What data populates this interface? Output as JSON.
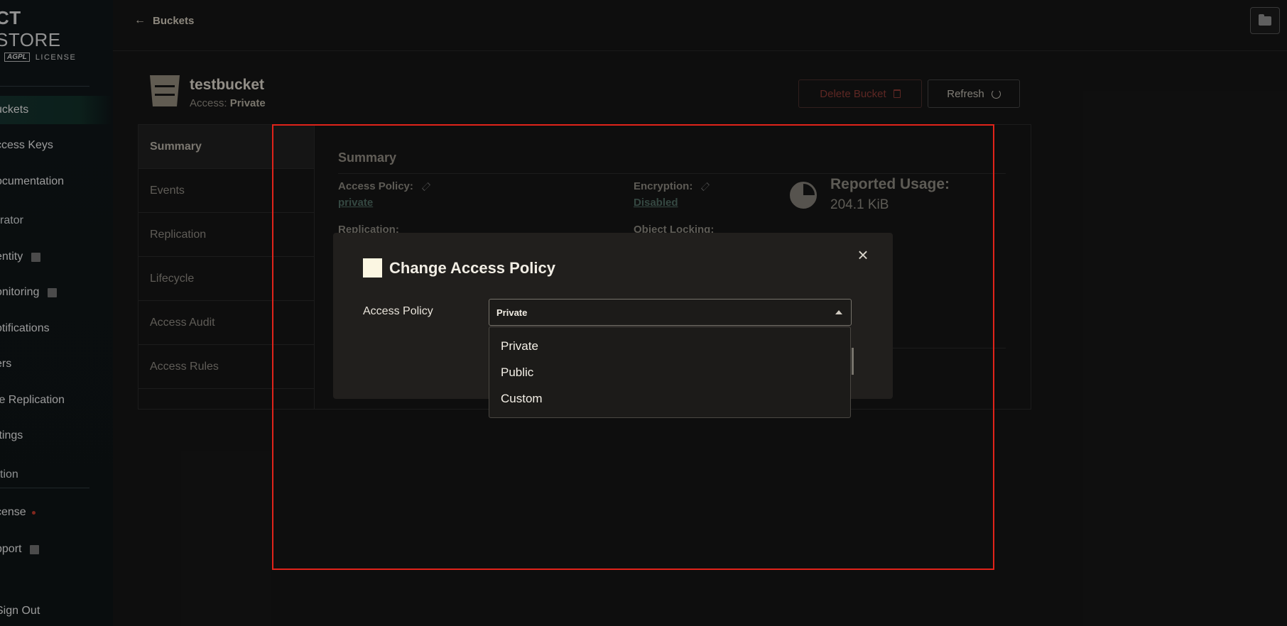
{
  "brand": {
    "name_bold": "CT",
    "name_rest": " STORE",
    "logo": "AGPL",
    "license": "LICENSE"
  },
  "sidebar": {
    "items": [
      {
        "label": "uckets"
      },
      {
        "label": "ccess Keys"
      },
      {
        "label": "ocumentation"
      },
      {
        "label": "entity"
      },
      {
        "label": "onitoring"
      },
      {
        "label": "otifications"
      },
      {
        "label": "ers"
      },
      {
        "label": "te Replication"
      },
      {
        "label": "ttings"
      },
      {
        "label": "cense"
      },
      {
        "label": "pport"
      },
      {
        "label": "Sign Out"
      }
    ],
    "sections": {
      "administrator": "rator",
      "subscription": "tion"
    }
  },
  "topbar": {
    "back_label": "Buckets",
    "back_icon": "arrow-left-icon",
    "folder_icon": "folder-icon"
  },
  "bucket": {
    "name": "testbucket",
    "access_prefix": "Access: ",
    "access_value": "Private",
    "delete_label": "Delete Bucket",
    "refresh_label": "Refresh"
  },
  "tabs": [
    "Summary",
    "Events",
    "Replication",
    "Lifecycle",
    "Access Audit",
    "Access Rules"
  ],
  "summary": {
    "title": "Summary",
    "access_policy_label": "Access Policy:",
    "access_policy_value": "private",
    "encryption_label": "Encryption:",
    "encryption_value": "Disabled",
    "replication_label": "Replication:",
    "object_locking_label": "Object Locking:",
    "usage_label": "Reported Usage:",
    "usage_value": "204.1 KiB"
  },
  "modal": {
    "title": "Change Access Policy",
    "field_label": "Access Policy",
    "selected": "Private",
    "options": [
      "Private",
      "Public",
      "Custom"
    ]
  },
  "colors": {
    "highlight": "#e0231a",
    "accent_link": "#4f6b62",
    "delete": "#8a3a34"
  }
}
